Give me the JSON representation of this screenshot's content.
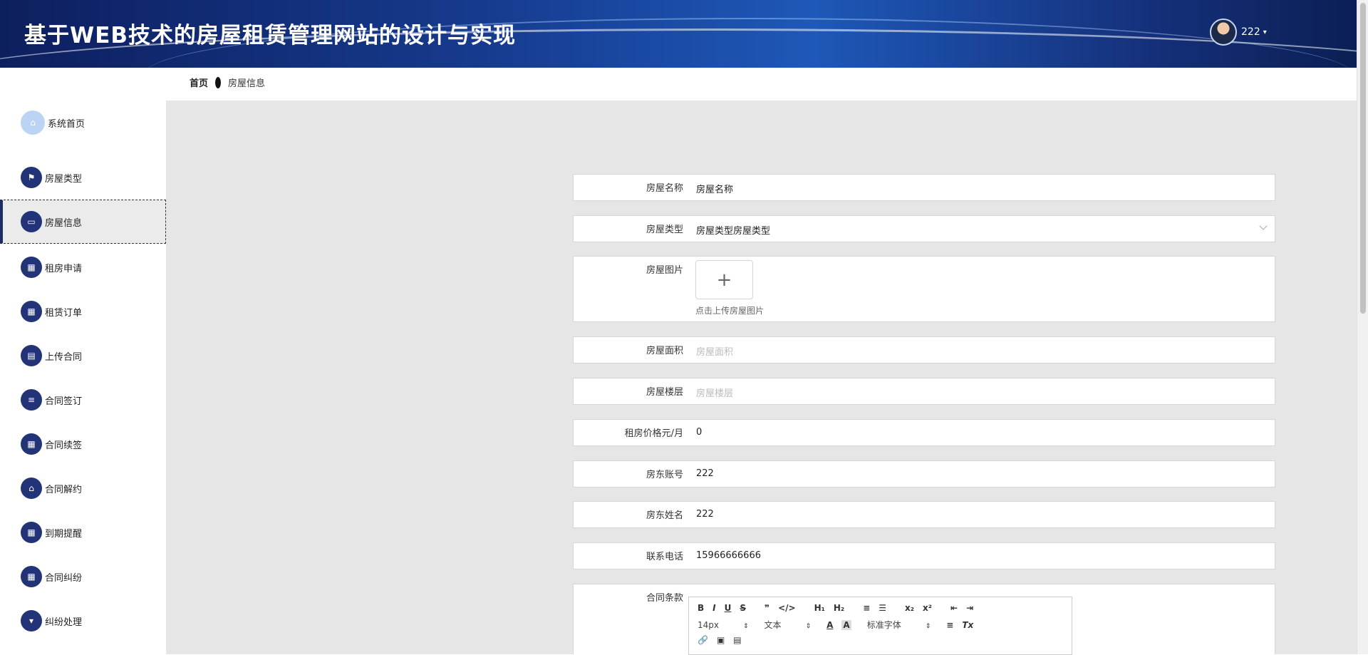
{
  "header": {
    "title": "基于WEB技术的房屋租赁管理网站的设计与实现",
    "user_name": "222",
    "caret": "▾"
  },
  "breadcrumb": {
    "home": "首页",
    "current": "房屋信息"
  },
  "sidebar": {
    "items": [
      {
        "label": "系统首页",
        "icon": "home-icon"
      },
      {
        "label": "房屋类型",
        "icon": "flag-icon"
      },
      {
        "label": "房屋信息",
        "icon": "monitor-icon",
        "active": true
      },
      {
        "label": "租房申请",
        "icon": "grid-icon"
      },
      {
        "label": "租赁订单",
        "icon": "grid-icon"
      },
      {
        "label": "上传合同",
        "icon": "chat-icon"
      },
      {
        "label": "合同签订",
        "icon": "sliders-icon"
      },
      {
        "label": "合同续签",
        "icon": "grid-icon"
      },
      {
        "label": "合同解约",
        "icon": "house-icon"
      },
      {
        "label": "到期提醒",
        "icon": "grid-icon"
      },
      {
        "label": "合同纠纷",
        "icon": "grid-icon"
      },
      {
        "label": "纠纷处理",
        "icon": "pin-icon"
      }
    ]
  },
  "form": {
    "house_name": {
      "label": "房屋名称",
      "value": "房屋名称"
    },
    "house_type": {
      "label": "房屋类型",
      "value": "房屋类型房屋类型"
    },
    "house_image": {
      "label": "房屋图片",
      "hint": "点击上传房屋图片"
    },
    "house_area": {
      "label": "房屋面积",
      "placeholder": "房屋面积"
    },
    "house_floor": {
      "label": "房屋楼层",
      "placeholder": "房屋楼层"
    },
    "rent_price": {
      "label": "租房价格元/月",
      "value": "0"
    },
    "landlord_account": {
      "label": "房东账号",
      "value": "222"
    },
    "landlord_name": {
      "label": "房东姓名",
      "value": "222"
    },
    "phone": {
      "label": "联系电话",
      "value": "15966666666"
    },
    "contract_terms": {
      "label": "合同条款"
    }
  },
  "editor": {
    "row1": [
      "B",
      "I",
      "U",
      "S",
      "❞",
      "</>",
      "H₁",
      "H₂",
      "≡",
      "☰",
      "x₂",
      "x²",
      "⇤",
      "⇥"
    ],
    "font_size": "14px",
    "text_style": "文本",
    "font_family": "标准字体",
    "row3": [
      "🔗",
      "▣",
      "▤"
    ]
  }
}
